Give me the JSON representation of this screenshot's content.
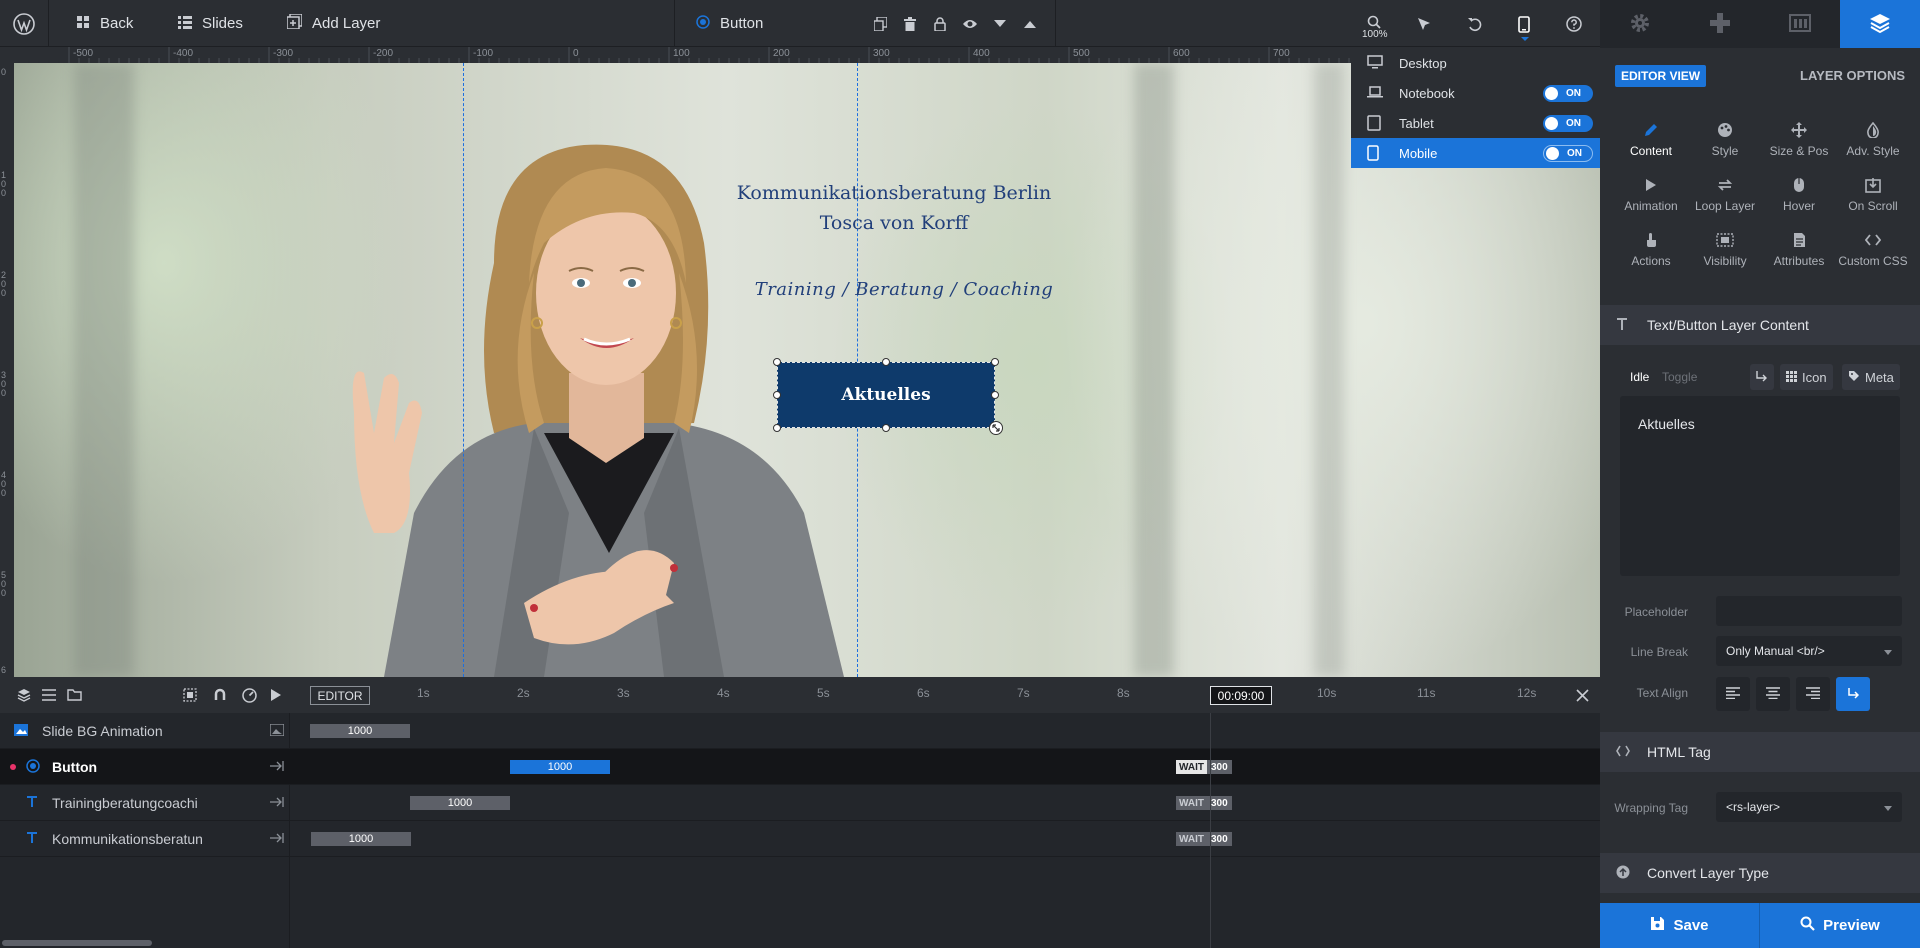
{
  "topbar": {
    "back_label": "Back",
    "slides_label": "Slides",
    "add_layer_label": "Add Layer",
    "selected_layer_label": "Button",
    "zoom_label": "100%"
  },
  "ruler": {
    "top_labels": [
      "-500",
      "-400",
      "-300",
      "-200",
      "-100",
      "0",
      "100",
      "200",
      "300",
      "400",
      "500",
      "600",
      "700"
    ],
    "left_labels": [
      "0",
      "100",
      "200",
      "300",
      "400",
      "500",
      "6"
    ]
  },
  "canvas": {
    "headline_line1": "Kommunikationsberatung Berlin",
    "headline_line2": "Tosca von Korff",
    "tagline": "Training / Beratung / Coaching",
    "button_text": "Aktuelles",
    "button_color": "#0e3a6b",
    "text_color": "#213f7a"
  },
  "device_menu": {
    "items": [
      {
        "label": "Desktop",
        "toggle": ""
      },
      {
        "label": "Notebook",
        "toggle": "ON"
      },
      {
        "label": "Tablet",
        "toggle": "ON"
      },
      {
        "label": "Mobile",
        "toggle": "ON"
      }
    ],
    "active": "Mobile"
  },
  "right_panel": {
    "editor_view": "EDITOR VIEW",
    "layer_options": "LAYER OPTIONS",
    "options": [
      {
        "label": "Content",
        "icon": "pencil-icon"
      },
      {
        "label": "Style",
        "icon": "palette-icon"
      },
      {
        "label": "Size & Pos",
        "icon": "move-icon"
      },
      {
        "label": "Adv. Style",
        "icon": "drop-icon"
      },
      {
        "label": "Animation",
        "icon": "play-icon"
      },
      {
        "label": "Loop Layer",
        "icon": "loop-icon"
      },
      {
        "label": "Hover",
        "icon": "mouse-icon"
      },
      {
        "label": "On Scroll",
        "icon": "scroll-icon"
      },
      {
        "label": "Actions",
        "icon": "hand-icon"
      },
      {
        "label": "Visibility",
        "icon": "visibility-icon"
      },
      {
        "label": "Attributes",
        "icon": "document-icon"
      },
      {
        "label": "Custom CSS",
        "icon": "code-icon"
      }
    ],
    "section_content": "Text/Button Layer Content",
    "idle_label": "Idle",
    "toggle_label": "Toggle",
    "icon_btn_label": "Icon",
    "meta_btn_label": "Meta",
    "content_text": "Aktuelles",
    "placeholder_label": "Placeholder",
    "placeholder_value": "",
    "line_break_label": "Line Break",
    "line_break_value": "Only Manual <br/>",
    "text_align_label": "Text Align",
    "section_html_tag": "HTML Tag",
    "wrapping_tag_label": "Wrapping Tag",
    "wrapping_tag_value": "<rs-layer>",
    "section_convert": "Convert Layer Type",
    "save_label": "Save",
    "preview_label": "Preview",
    "accent": "#1b74d9"
  },
  "timeline": {
    "editor_label": "EDITOR",
    "time_display": "00:09:00",
    "ticks": [
      "1s",
      "2s",
      "3s",
      "4s",
      "5s",
      "6s",
      "7s",
      "8s",
      "9s",
      "10s",
      "11s",
      "12s"
    ],
    "rows": [
      {
        "name": "Slide BG Animation",
        "bar": "1000",
        "wait": "",
        "value": ""
      },
      {
        "name": "Button",
        "bar": "1000",
        "wait": "WAIT",
        "value": "300"
      },
      {
        "name": "Trainingberatungcoachi",
        "bar": "1000",
        "wait": "WAIT",
        "value": "300"
      },
      {
        "name": "Kommunikationsberatun",
        "bar": "1000",
        "wait": "WAIT",
        "value": "300"
      }
    ]
  }
}
